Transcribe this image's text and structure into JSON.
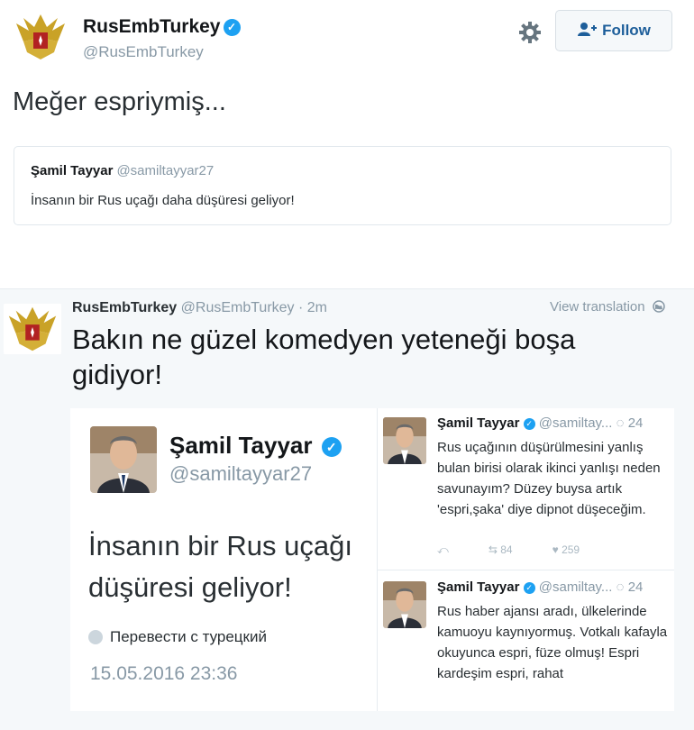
{
  "top_tweet": {
    "name": "RusEmbTurkey",
    "handle": "@RusEmbTurkey",
    "follow_label": "Follow",
    "text": "Meğer espriymiş...",
    "quote": {
      "name": "Şamil Tayyar",
      "handle": "@samiltayyar27",
      "text": "İnsanın bir Rus uçağı daha düşüresi geliyor!"
    }
  },
  "bottom_tweet": {
    "name": "RusEmbTurkey",
    "handle": "@RusEmbTurkey",
    "time": "· 2m",
    "view_translation": "View translation",
    "text": "Bakın ne güzel komedyen yeteneği boşa gidiyor!",
    "embed_main": {
      "name": "Şamil Tayyar",
      "handle": "@samiltayyar27",
      "text_line1": "İnsanın bir Rus uçağı",
      "text_line2": "düşüresi geliyor!",
      "translate": "Перевести с турецкий",
      "date": "15.05.2016 23:36"
    },
    "embed_side": [
      {
        "name": "Şamil Tayyar",
        "handle": "@samiltay...",
        "time": "24",
        "text": "Rus uçağının düşürülmesini yanlış bulan birisi olarak ikinci yanlışı neden savunayım? Düzey buysa artık 'espri,şaka' diye dipnot düşeceğim.",
        "retweets": "84",
        "likes": "259"
      },
      {
        "name": "Şamil Tayyar",
        "handle": "@samiltay...",
        "time": "24",
        "text": "Rus haber ajansı aradı, ülkelerinde kamuoyu kaynıyormuş. Votkalı kafayla okuyunca espri, füze olmuş! Espri kardeşim espri, rahat"
      }
    ]
  },
  "colors": {
    "accent": "#1da1f2",
    "follow_text": "#1d5e9a",
    "muted": "#8899a6",
    "background_alt": "#f5f8fa"
  }
}
